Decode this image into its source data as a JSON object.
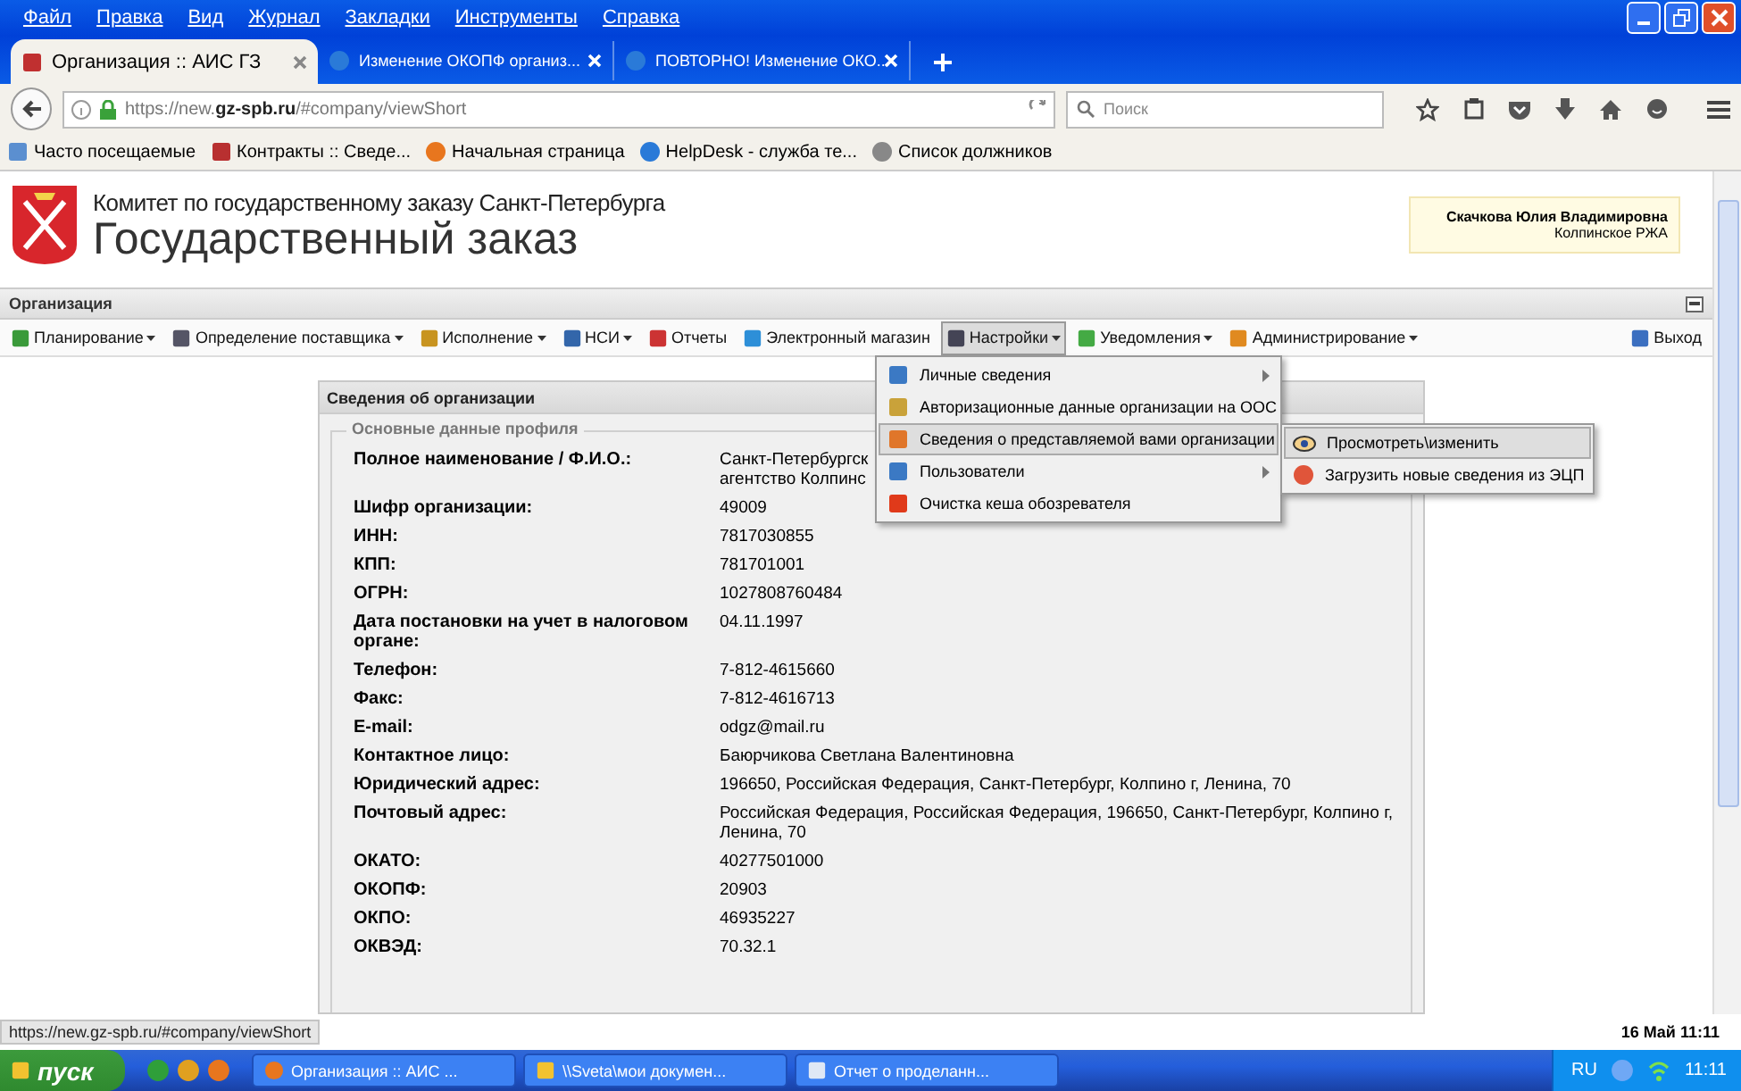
{
  "browser": {
    "menu": [
      "Файл",
      "Правка",
      "Вид",
      "Журнал",
      "Закладки",
      "Инструменты",
      "Справка"
    ],
    "tabs": [
      {
        "title": "Организация :: АИС ГЗ",
        "selected": true
      },
      {
        "title": "Изменение ОКОПФ организ...",
        "selected": false
      },
      {
        "title": "ПОВТОРНО! Изменение ОКО...",
        "selected": false
      }
    ],
    "url": "https://new.**gz-spb.ru**/#company/viewShort",
    "search_placeholder": "Поиск",
    "bookmarks": [
      "Часто посещаемые",
      "Контракты :: Сведе...",
      "Начальная страница",
      "HelpDesk - служба те...",
      "Список должников"
    ]
  },
  "header": {
    "subtitle": "Комитет по государственному заказу Санкт-Петербурга",
    "title": "Государственный заказ",
    "user_name": "Скачкова Юлия Владимировна",
    "user_org": "Колпинское РЖА"
  },
  "panel": {
    "title": "Организация"
  },
  "toolbar": [
    {
      "label": "Планирование",
      "dropdown": true,
      "selected": false
    },
    {
      "label": "Определение поставщика",
      "dropdown": true,
      "selected": false
    },
    {
      "label": "Исполнение",
      "dropdown": true,
      "selected": false
    },
    {
      "label": "НСИ",
      "dropdown": true,
      "selected": false
    },
    {
      "label": "Отчеты",
      "dropdown": false,
      "selected": false
    },
    {
      "label": "Электронный магазин",
      "dropdown": false,
      "selected": false
    },
    {
      "label": "Настройки",
      "dropdown": true,
      "selected": true
    },
    {
      "label": "Уведомления",
      "dropdown": true,
      "selected": false
    },
    {
      "label": "Администрирование",
      "dropdown": true,
      "selected": false
    }
  ],
  "exit": "Выход",
  "menu": [
    {
      "label": "Личные сведения",
      "submenu": true,
      "selected": false
    },
    {
      "label": "Авторизационные данные организации на ООС",
      "submenu": false,
      "selected": false
    },
    {
      "label": "Сведения о представляемой вами организации",
      "submenu": true,
      "selected": true
    },
    {
      "label": "Пользователи",
      "submenu": true,
      "selected": false
    },
    {
      "label": "Очистка кеша обозревателя",
      "submenu": false,
      "selected": false
    }
  ],
  "submenu": [
    {
      "label": "Просмотреть\\изменить",
      "selected": true
    },
    {
      "label": "Загрузить новые сведения из ЭЦП",
      "selected": false
    }
  ],
  "card": {
    "title": "Сведения об организации",
    "section": "Основные данные профиля",
    "fields": [
      {
        "label": "Полное наименование / Ф.И.О.:",
        "value": "Санкт-Петербургск\nагентство Колпинс"
      },
      {
        "label": "Шифр организации:",
        "value": "49009"
      },
      {
        "label": "ИНН:",
        "value": "7817030855"
      },
      {
        "label": "КПП:",
        "value": "781701001"
      },
      {
        "label": "ОГРН:",
        "value": "1027808760484"
      },
      {
        "label": "Дата постановки на учет в налоговом органе:",
        "value": "04.11.1997"
      },
      {
        "label": "Телефон:",
        "value": "7-812-4615660"
      },
      {
        "label": "Факс:",
        "value": "7-812-4616713"
      },
      {
        "label": "E-mail:",
        "value": "odgz@mail.ru"
      },
      {
        "label": "Контактное лицо:",
        "value": "Баюрчикова Светлана Валентиновна"
      },
      {
        "label": "Юридический адрес:",
        "value": "196650, Российская Федерация, Санкт-Петербург, Колпино г, Ленина, 70"
      },
      {
        "label": "Почтовый адрес:",
        "value": "Российская Федерация, Российская Федерация, 196650, Санкт-Петербург, Колпино г, Ленина, 70"
      },
      {
        "label": "ОКАТО:",
        "value": "40277501000"
      },
      {
        "label": "ОКОПФ:",
        "value": "20903"
      },
      {
        "label": "ОКПО:",
        "value": "46935227"
      },
      {
        "label": "ОКВЭД:",
        "value": "70.32.1"
      }
    ]
  },
  "status_url": "https://new.gz-spb.ru/#company/viewShort",
  "taskbar": {
    "start": "пуск",
    "tasks": [
      "Организация :: АИС ...",
      "\\\\Sveta\\мои докумен...",
      "Отчет о проделанн..."
    ],
    "date_tip": "16 Май 11:11",
    "lang": "RU",
    "clock": "11:11"
  }
}
